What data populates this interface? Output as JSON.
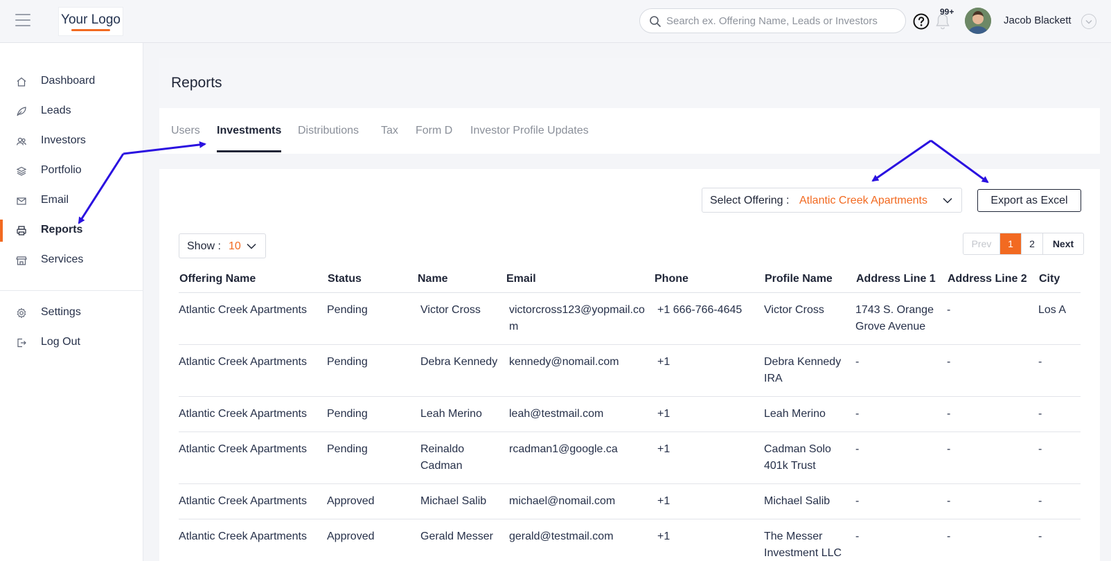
{
  "header": {
    "logo_text": "Your Logo",
    "search_placeholder": "Search ex. Offering Name, Leads or Investors",
    "notification_count": "99+",
    "user_name": "Jacob Blackett"
  },
  "sidebar": {
    "items": [
      {
        "label": "Dashboard",
        "icon": "home-icon"
      },
      {
        "label": "Leads",
        "icon": "leaf-icon"
      },
      {
        "label": "Investors",
        "icon": "users-icon"
      },
      {
        "label": "Portfolio",
        "icon": "layers-icon"
      },
      {
        "label": "Email",
        "icon": "mail-icon"
      },
      {
        "label": "Reports",
        "icon": "printer-icon",
        "active": true
      },
      {
        "label": "Services",
        "icon": "store-icon"
      }
    ],
    "bottom_items": [
      {
        "label": "Settings",
        "icon": "gear-icon"
      },
      {
        "label": "Log Out",
        "icon": "logout-icon"
      }
    ]
  },
  "page": {
    "title": "Reports",
    "tabs": [
      {
        "label": "Users"
      },
      {
        "label": "Investments",
        "active": true
      },
      {
        "label": "Distributions"
      },
      {
        "label": "Tax"
      },
      {
        "label": "Form D"
      },
      {
        "label": "Investor Profile Updates"
      }
    ]
  },
  "filters": {
    "offering_label": "Select Offering :",
    "offering_value": "Atlantic Creek Apartments",
    "export_label": "Export as Excel",
    "show_label": "Show :",
    "show_value": "10"
  },
  "pagination": {
    "prev": "Prev",
    "pages": [
      "1",
      "2"
    ],
    "current": "1",
    "next": "Next"
  },
  "table": {
    "columns": [
      "Offering Name",
      "Status",
      "Name",
      "Email",
      "Phone",
      "Profile Name",
      "Address Line 1",
      "Address Line 2",
      "City"
    ],
    "rows": [
      [
        "Atlantic Creek Apartments",
        "Pending",
        "Victor Cross",
        "victorcross123@yopmail.com",
        "+1 666-766-4645",
        "Victor Cross",
        "1743 S. Orange Grove Avenue",
        "-",
        "Los A"
      ],
      [
        "Atlantic Creek Apartments",
        "Pending",
        "Debra Kennedy",
        "kennedy@nomail.com",
        "+1",
        "Debra Kennedy IRA",
        "-",
        "-",
        "-"
      ],
      [
        "Atlantic Creek Apartments",
        "Pending",
        "Leah Merino",
        "leah@testmail.com",
        "+1",
        "Leah Merino",
        "-",
        "-",
        "-"
      ],
      [
        "Atlantic Creek Apartments",
        "Pending",
        "Reinaldo Cadman",
        "rcadman1@google.ca",
        "+1",
        "Cadman Solo 401k Trust",
        "-",
        "-",
        "-"
      ],
      [
        "Atlantic Creek Apartments",
        "Approved",
        "Michael Salib",
        "michael@nomail.com",
        "+1",
        "Michael Salib",
        "-",
        "-",
        "-"
      ],
      [
        "Atlantic Creek Apartments",
        "Approved",
        "Gerald Messer",
        "gerald@testmail.com",
        "+1",
        "The Messer Investment LLC",
        "-",
        "-",
        "-"
      ]
    ]
  },
  "colors": {
    "accent": "#f26a21",
    "annotation_arrow": "#2a11e0",
    "text_dark": "#1f2537"
  }
}
